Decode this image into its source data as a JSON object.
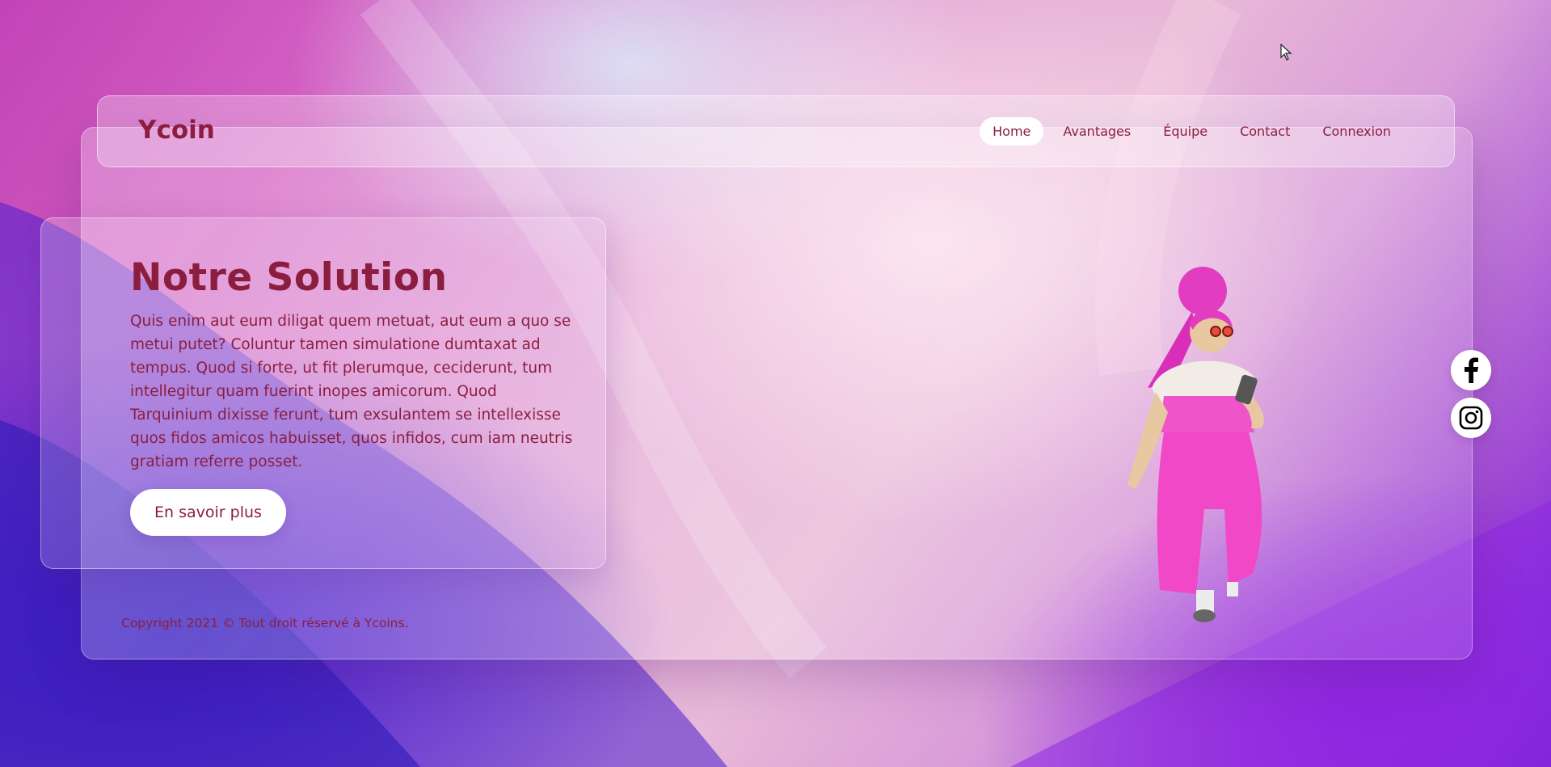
{
  "brand": {
    "name": "Ycoin"
  },
  "nav": {
    "items": [
      {
        "label": "Home",
        "active": true
      },
      {
        "label": "Avantages",
        "active": false
      },
      {
        "label": "Équipe",
        "active": false
      },
      {
        "label": "Contact",
        "active": false
      },
      {
        "label": "Connexion",
        "active": false
      }
    ]
  },
  "hero": {
    "title": "Notre Solution",
    "text": "Quis enim aut eum diligat quem metuat, aut eum a quo se metui putet? Coluntur tamen simulatione dumtaxat ad tempus. Quod si forte, ut fit plerumque, ceciderunt, tum intellegitur quam fuerint inopes amicorum. Quod Tarquinium dixisse ferunt, tum exsulantem se intellexisse quos fidos amicos habuisset, quos infidos, cum iam neutris gratiam referre posset.",
    "cta_label": "En savoir plus"
  },
  "footer": {
    "copyright": "Copyright 2021 © Tout droit réservé à Ycoins."
  },
  "social": {
    "icons": [
      "facebook-icon",
      "instagram-icon"
    ]
  },
  "colors": {
    "brand_text": "#8b1e3f",
    "button_bg": "#ffffff"
  }
}
